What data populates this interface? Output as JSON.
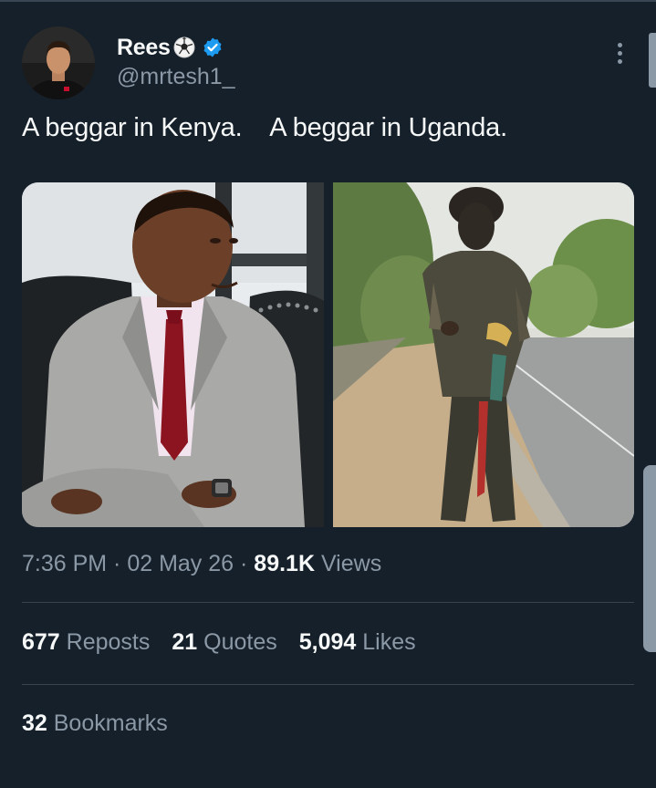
{
  "author": {
    "display_name": "Rees",
    "handle": "@mrtesh1_",
    "verified": true,
    "avatar_icon": "user-avatar",
    "emoji_icon": "soccer-ball-icon"
  },
  "tweet": {
    "text": "A beggar in Kenya.    A beggar in Uganda.",
    "media": [
      {
        "description_icon": "photo-man-in-suit"
      },
      {
        "description_icon": "photo-man-on-roadside"
      }
    ]
  },
  "meta": {
    "time": "7:36 PM",
    "separator": " · ",
    "date": "02 May 26",
    "views_count": "89.1K",
    "views_label": " Views"
  },
  "stats": {
    "reposts_count": "677",
    "reposts_label": " Reposts",
    "quotes_count": "21",
    "quotes_label": " Quotes",
    "likes_count": "5,094",
    "likes_label": " Likes",
    "bookmarks_count": "32",
    "bookmarks_label": " Bookmarks"
  },
  "colors": {
    "background": "#15202b",
    "text_primary": "#f7f9f9",
    "text_secondary": "#8b98a5",
    "verified": "#1d9bf0",
    "divider": "#38444d"
  }
}
